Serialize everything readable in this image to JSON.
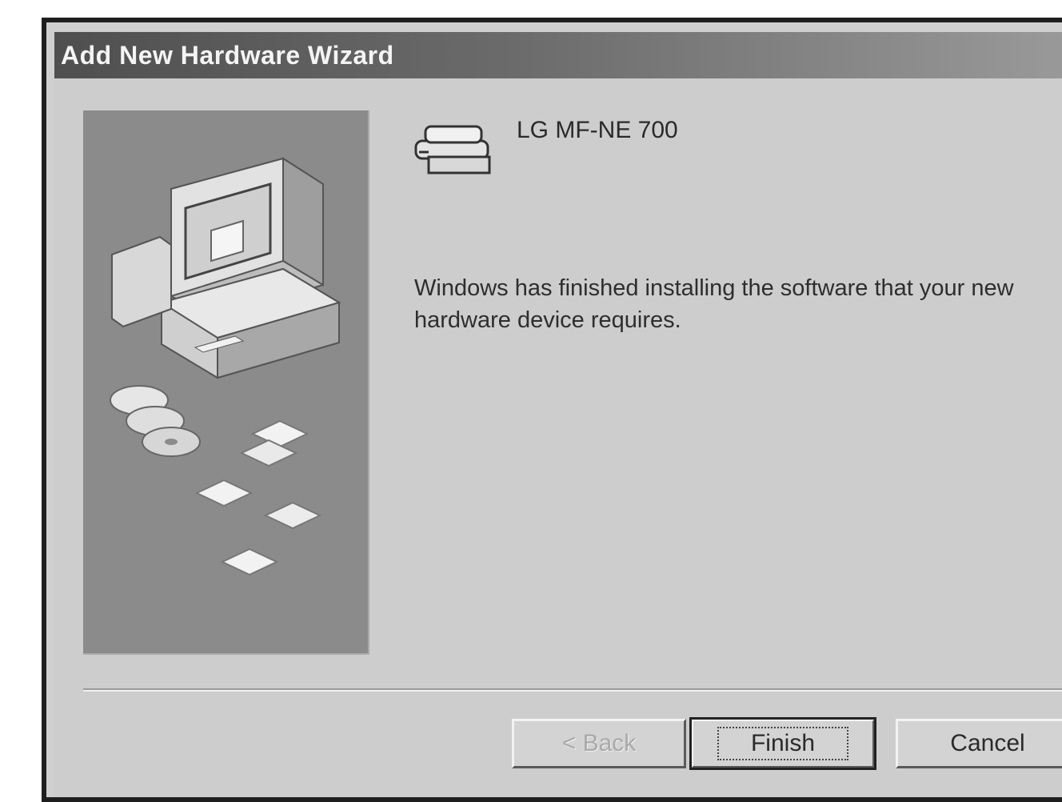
{
  "window": {
    "title": "Add New Hardware Wizard"
  },
  "device": {
    "icon": "hardware-device-icon",
    "name": "LG MF-NE 700"
  },
  "main": {
    "message": "Windows has finished installing the software that your new hardware device requires."
  },
  "side_panel": {
    "illustration": "computer-with-disks-illustration"
  },
  "buttons": {
    "back_label": "< Back",
    "finish_label": "Finish",
    "cancel_label": "Cancel"
  }
}
